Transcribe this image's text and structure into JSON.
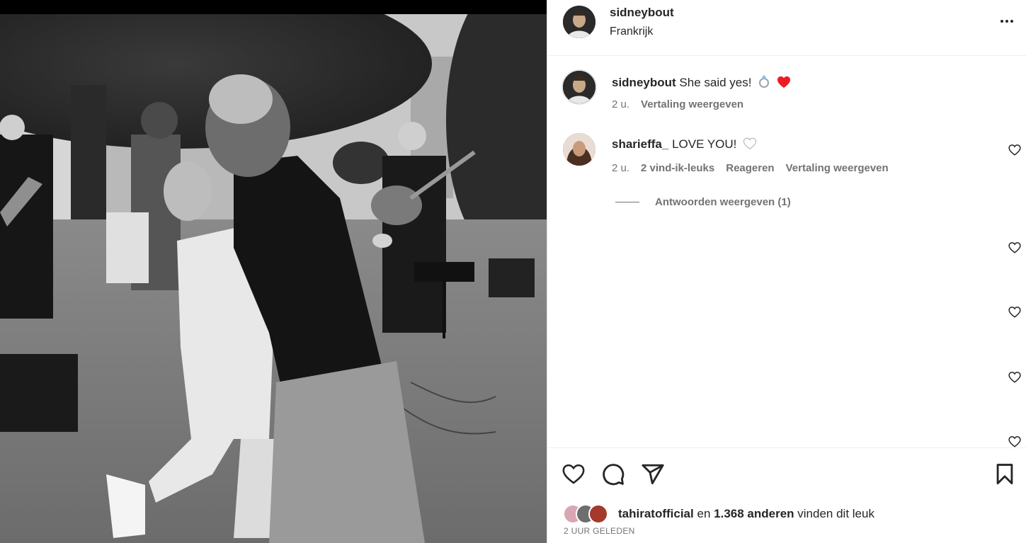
{
  "header": {
    "username": "sidneybout",
    "location": "Frankrijk",
    "more_icon": "more-horizontal-icon"
  },
  "caption": {
    "username": "sidneybout",
    "text": "She said yes!",
    "emojis": [
      "ring-icon",
      "red-heart-icon"
    ],
    "time": "2 u.",
    "translate": "Vertaling weergeven"
  },
  "comment": {
    "username": "sharieffa_",
    "text": "LOVE YOU!",
    "emoji": "white-heart-icon",
    "time": "2 u.",
    "likes": "2 vind-ik-leuks",
    "reply": "Reageren",
    "translate": "Vertaling weergeven",
    "view_replies": "Antwoorden weergeven (1)"
  },
  "actions": {
    "icons": [
      "heart-icon",
      "comment-icon",
      "share-icon",
      "bookmark-icon"
    ]
  },
  "likes": {
    "user": "tahiratofficial",
    "connector": "en",
    "count": "1.368 anderen",
    "suffix": "vinden dit leuk"
  },
  "timestamp": "2 UUR GELEDEN",
  "colors": {
    "text": "#262626",
    "secondary": "#737373",
    "divider": "#efefef",
    "red_heart": "#ed1c24"
  }
}
